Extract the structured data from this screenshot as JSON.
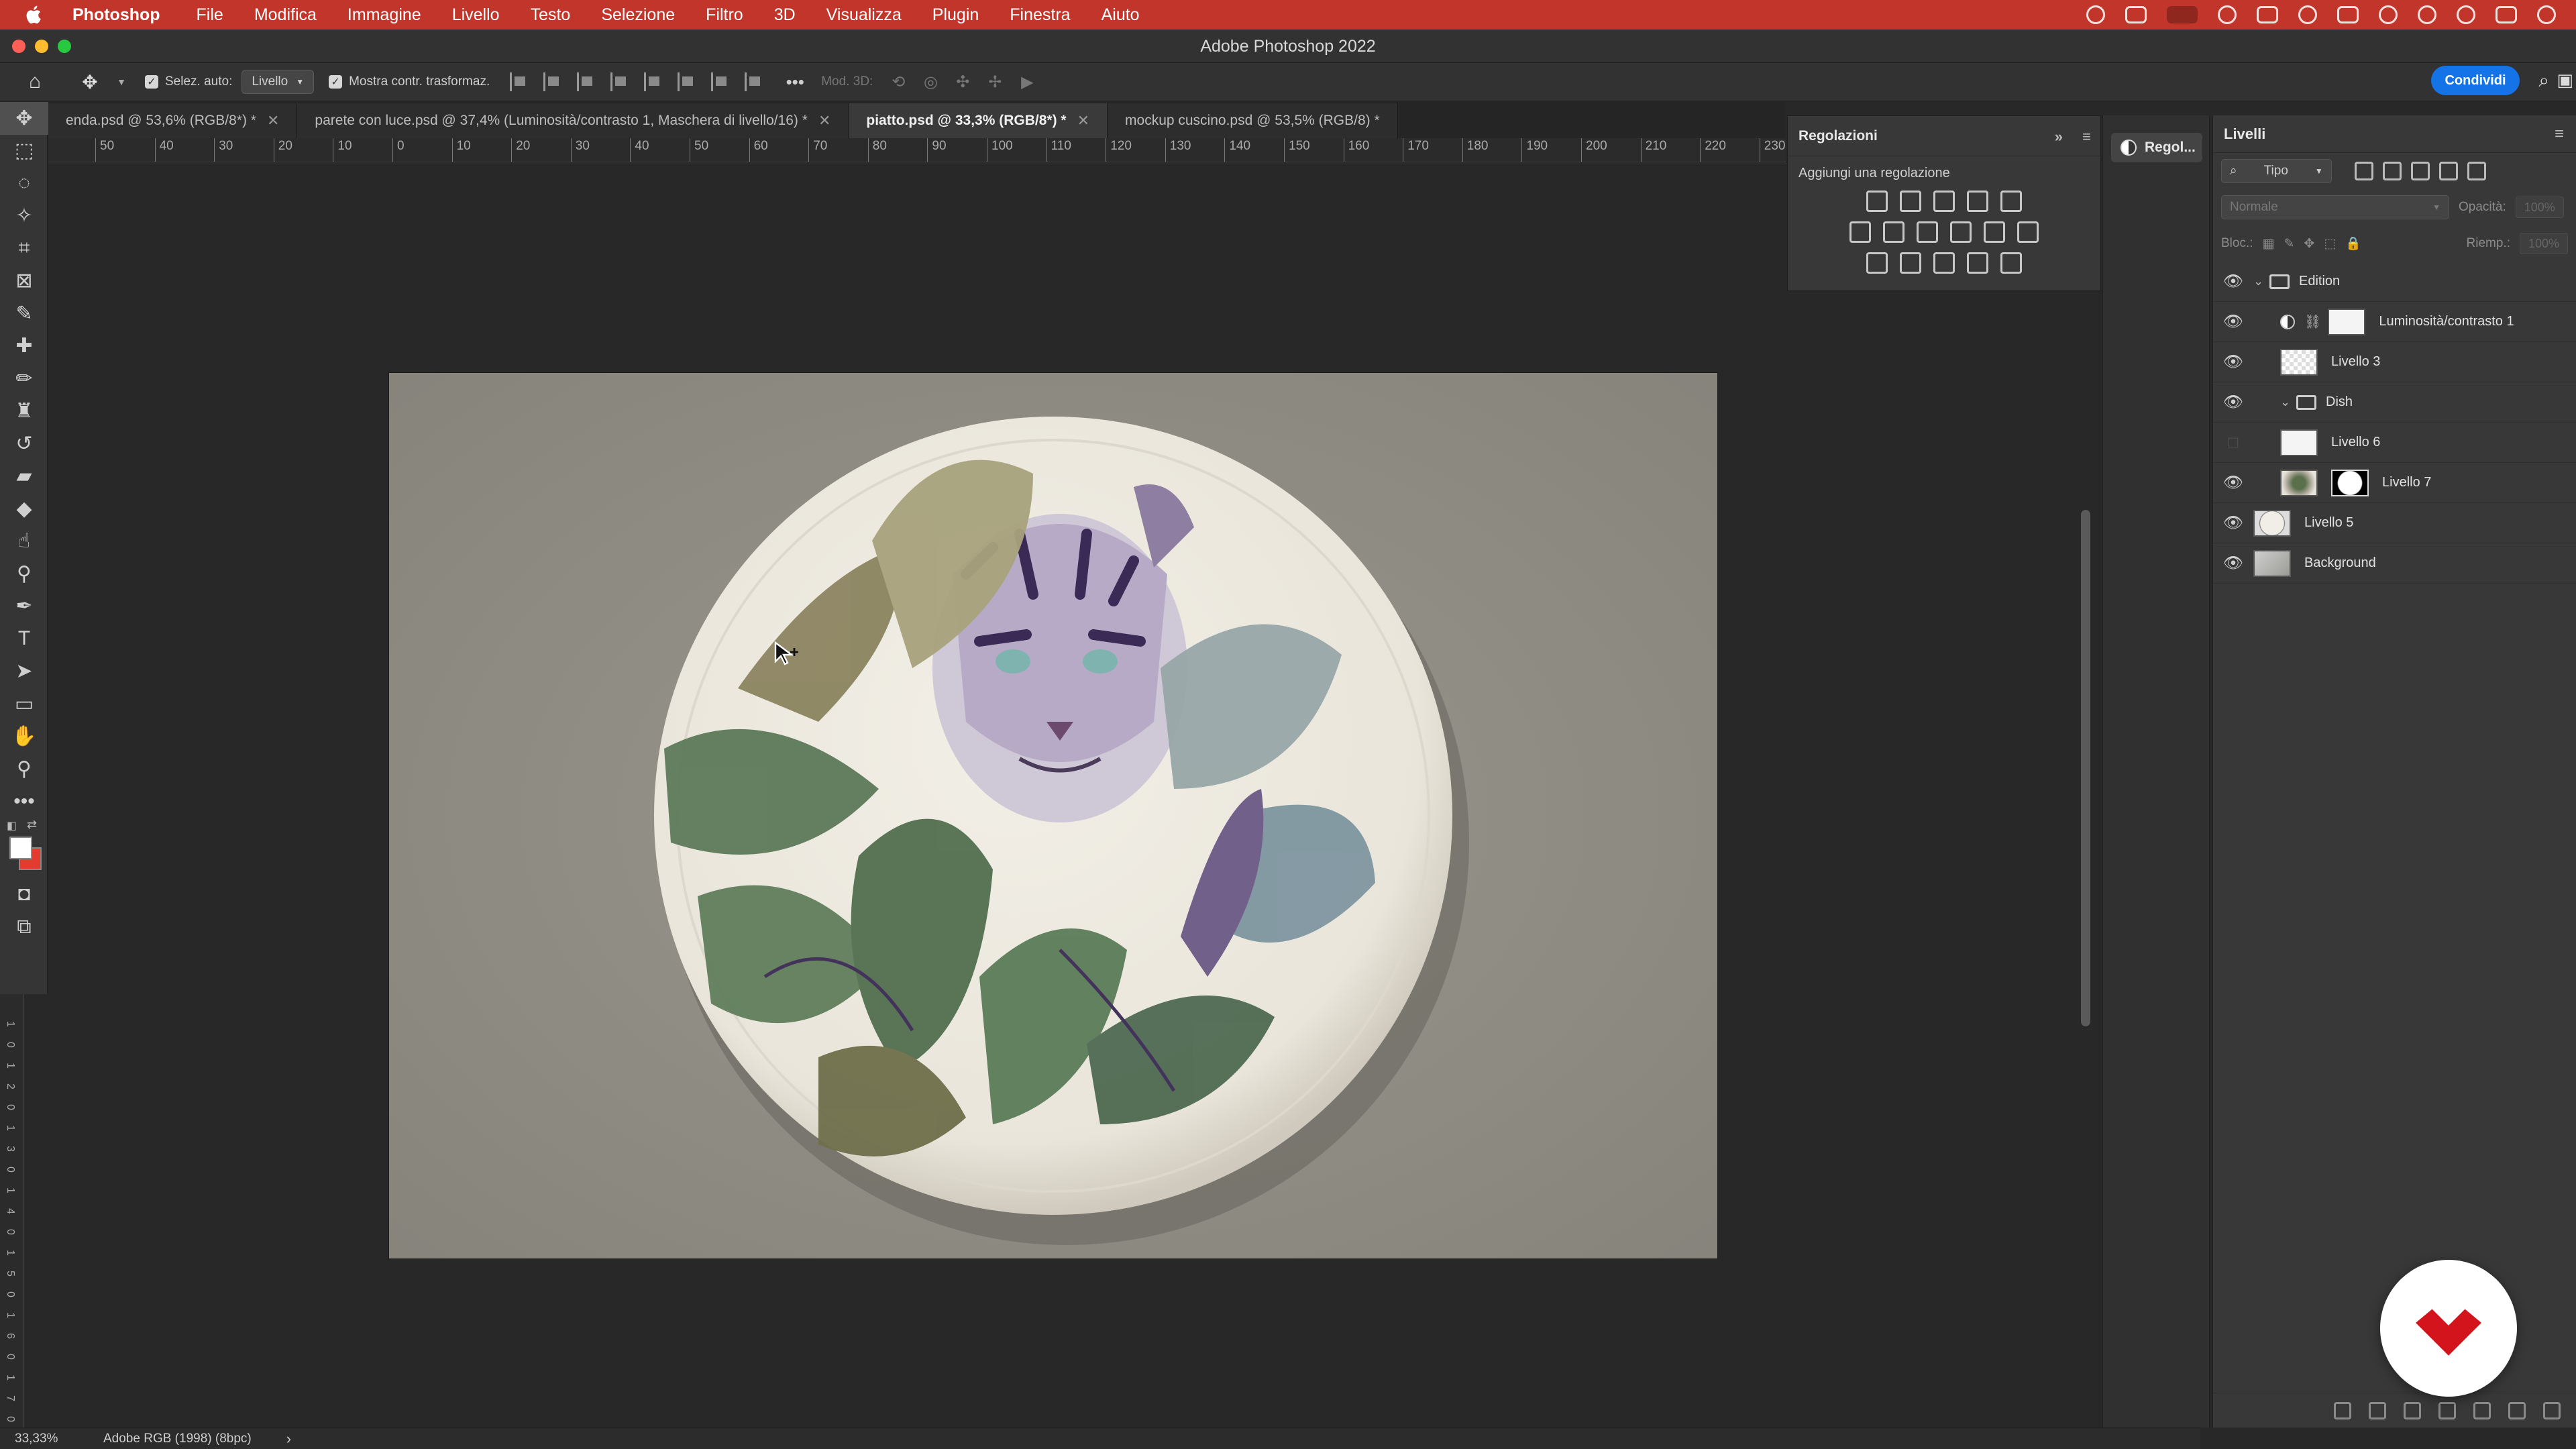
{
  "menubar": {
    "app": "Photoshop",
    "items": [
      "File",
      "Modifica",
      "Immagine",
      "Livello",
      "Testo",
      "Selezione",
      "Filtro",
      "3D",
      "Visualizza",
      "Plugin",
      "Finestra",
      "Aiuto"
    ],
    "accent": "#c1352a"
  },
  "window": {
    "title": "Adobe Photoshop 2022"
  },
  "options": {
    "auto_select_label": "Selez. auto:",
    "auto_select_value": "Livello",
    "transform_label": "Mostra contr. trasformaz.",
    "mode3d_label": "Mod. 3D:",
    "share_label": "Condividi"
  },
  "tabs": [
    {
      "label": "enda.psd @ 53,6% (RGB/8*) *",
      "active": false
    },
    {
      "label": "parete con luce.psd @ 37,4% (Luminosità/contrasto 1, Maschera di livello/16) *",
      "active": false
    },
    {
      "label": "piatto.psd @ 33,3% (RGB/8*) *",
      "active": true
    },
    {
      "label": "mockup cuscino.psd @ 53,5% (RGB/8) *",
      "active": false
    }
  ],
  "ruler": {
    "marks": [
      "50",
      "40",
      "30",
      "20",
      "10",
      "0",
      "10",
      "20",
      "30",
      "40",
      "50",
      "60",
      "70",
      "80",
      "90",
      "100",
      "110",
      "120",
      "130",
      "140",
      "150",
      "160",
      "170",
      "180",
      "190",
      "200",
      "210",
      "220",
      "230"
    ],
    "vmarks": [
      "1",
      "0",
      "1",
      "2",
      "0",
      "1",
      "3",
      "0",
      "1",
      "4",
      "0",
      "1",
      "5",
      "0",
      "1",
      "6",
      "0",
      "1",
      "7",
      "0"
    ]
  },
  "status": {
    "zoom": "33,33%",
    "profile": "Adobe RGB (1998) (8bpc)",
    "arrow": "›"
  },
  "adjustments": {
    "title": "Regolazioni",
    "subtitle": "Aggiungi una regolazione",
    "collapsed_label": "Regol..."
  },
  "layers": {
    "title": "Livelli",
    "filter": "Tipo",
    "blend": "Normale",
    "opacity_label": "Opacità:",
    "opacity_value": "100%",
    "lock_label": "Bloc.:",
    "fill_label": "Riemp.:",
    "fill_value": "100%",
    "items": [
      {
        "name": "Edition",
        "kind": "group",
        "visible": true
      },
      {
        "name": "Luminosità/contrasto 1",
        "kind": "adjustment",
        "visible": true
      },
      {
        "name": "Livello 3",
        "kind": "pixel",
        "visible": true
      },
      {
        "name": "Dish",
        "kind": "group",
        "visible": true
      },
      {
        "name": "Livello 6",
        "kind": "pixel",
        "visible": false
      },
      {
        "name": "Livello 7",
        "kind": "pixel-masked",
        "visible": true
      },
      {
        "name": "Livello 5",
        "kind": "pixel",
        "visible": true
      },
      {
        "name": "Background",
        "kind": "background",
        "visible": true
      }
    ]
  }
}
